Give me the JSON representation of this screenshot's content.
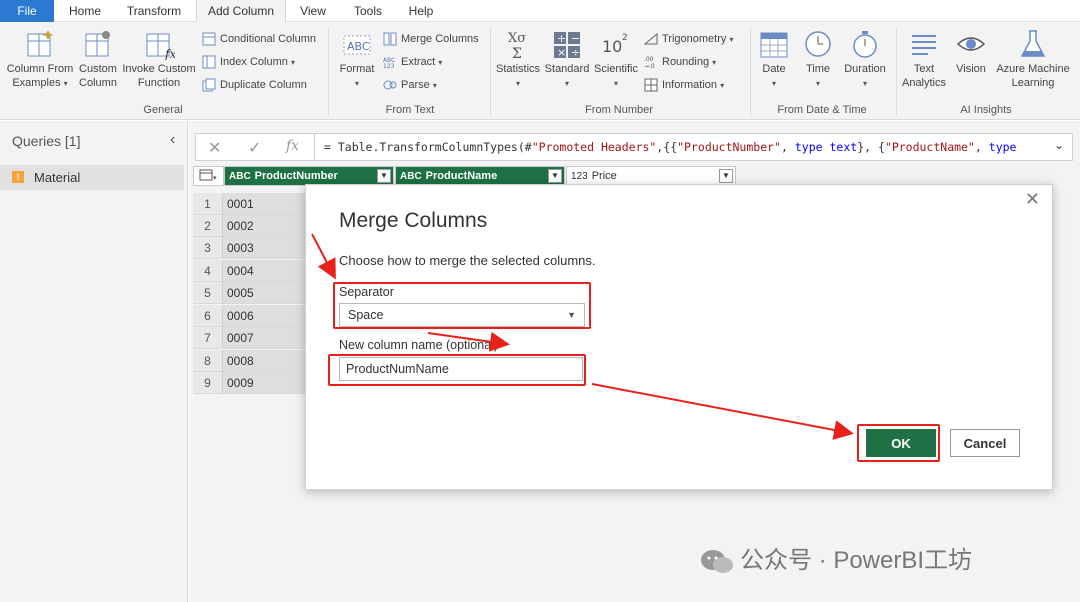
{
  "menu": {
    "tabs": [
      "File",
      "Home",
      "Transform",
      "Add Column",
      "View",
      "Tools",
      "Help"
    ],
    "active_tab": "Add Column"
  },
  "ribbon": {
    "general": {
      "label": "General",
      "column_from_examples": [
        "Column From",
        "Examples"
      ],
      "custom_column": [
        "Custom",
        "Column"
      ],
      "invoke_custom_function": [
        "Invoke Custom",
        "Function"
      ],
      "conditional_column": "Conditional Column",
      "index_column": "Index Column",
      "duplicate_column": "Duplicate Column"
    },
    "from_text": {
      "label": "From Text",
      "format": "Format",
      "merge_columns": "Merge Columns",
      "extract": "Extract",
      "parse": "Parse"
    },
    "from_number": {
      "label": "From Number",
      "statistics": "Statistics",
      "standard": "Standard",
      "scientific": "Scientific",
      "trigonometry": "Trigonometry",
      "rounding": "Rounding",
      "information": "Information"
    },
    "from_date_time": {
      "label": "From Date & Time",
      "date": "Date",
      "time": "Time",
      "duration": "Duration"
    },
    "ai_insights": {
      "label": "AI Insights",
      "text_analytics": [
        "Text",
        "Analytics"
      ],
      "vision": "Vision",
      "azure_ml": [
        "Azure Machine",
        "Learning"
      ]
    }
  },
  "queries": {
    "title": "Queries [1]",
    "items": [
      {
        "label": "Material",
        "warning": "!"
      }
    ]
  },
  "formula_bar": {
    "fx": "fx",
    "prefix": "= Table.TransformColumnTypes(#",
    "s1": "\"Promoted Headers\"",
    "mid1": ",{{",
    "s2": "\"ProductNumber\"",
    "mid2": ", ",
    "k1": "type",
    "sp1": " ",
    "k2": "text",
    "mid3": "}, {",
    "s3": "\"ProductName\"",
    "mid4": ", ",
    "k3": "type"
  },
  "table": {
    "columns": [
      {
        "type": "ABC",
        "name": "ProductNumber"
      },
      {
        "type": "ABC",
        "name": "ProductName"
      },
      {
        "type": "123",
        "name": "Price"
      }
    ],
    "rows": [
      {
        "n": "1",
        "v": "0001"
      },
      {
        "n": "2",
        "v": "0002"
      },
      {
        "n": "3",
        "v": "0003"
      },
      {
        "n": "4",
        "v": "0004"
      },
      {
        "n": "5",
        "v": "0005"
      },
      {
        "n": "6",
        "v": "0006"
      },
      {
        "n": "7",
        "v": "0007"
      },
      {
        "n": "8",
        "v": "0008"
      },
      {
        "n": "9",
        "v": "0009"
      }
    ]
  },
  "dialog": {
    "title": "Merge Columns",
    "close": "✕",
    "description": "Choose how to merge the selected columns.",
    "separator_label": "Separator",
    "separator_value": "Space",
    "new_column_label": "New column name (optional)",
    "new_column_value": "ProductNumName",
    "ok": "OK",
    "cancel": "Cancel"
  },
  "annotation_color": "#e8211b",
  "accent_green": "#1e7145",
  "file_tab_color": "#2b79d0",
  "watermark": "公众号 · PowerBI工坊"
}
